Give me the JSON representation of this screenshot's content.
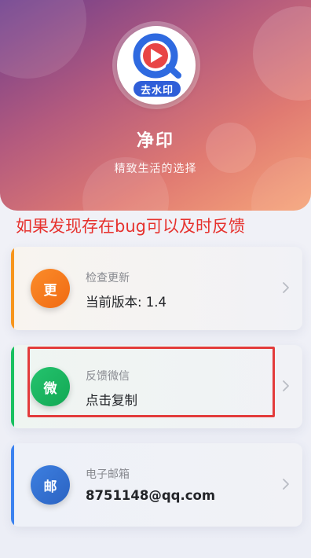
{
  "header": {
    "logo_badge": "去水印",
    "app_name": "净印",
    "slogan": "精致生活的选择"
  },
  "notice": "如果发现存在bug可以及时反馈",
  "cards": [
    {
      "id": "update",
      "badge": "更",
      "subtitle": "检查更新",
      "title": "当前版本: 1.4",
      "icon": "chevron-right-icon"
    },
    {
      "id": "wechat",
      "badge": "微",
      "subtitle": "反馈微信",
      "title": "点击复制",
      "icon": "chevron-right-icon"
    },
    {
      "id": "email",
      "badge": "邮",
      "subtitle": "电子邮箱",
      "title": "8751148@qq.com",
      "icon": "chevron-right-icon"
    }
  ],
  "colors": {
    "update_accent": "#f7961e",
    "wechat_accent": "#19c160",
    "email_accent": "#3b82f0",
    "notice": "#e6322e",
    "highlight": "#e33b3b"
  }
}
